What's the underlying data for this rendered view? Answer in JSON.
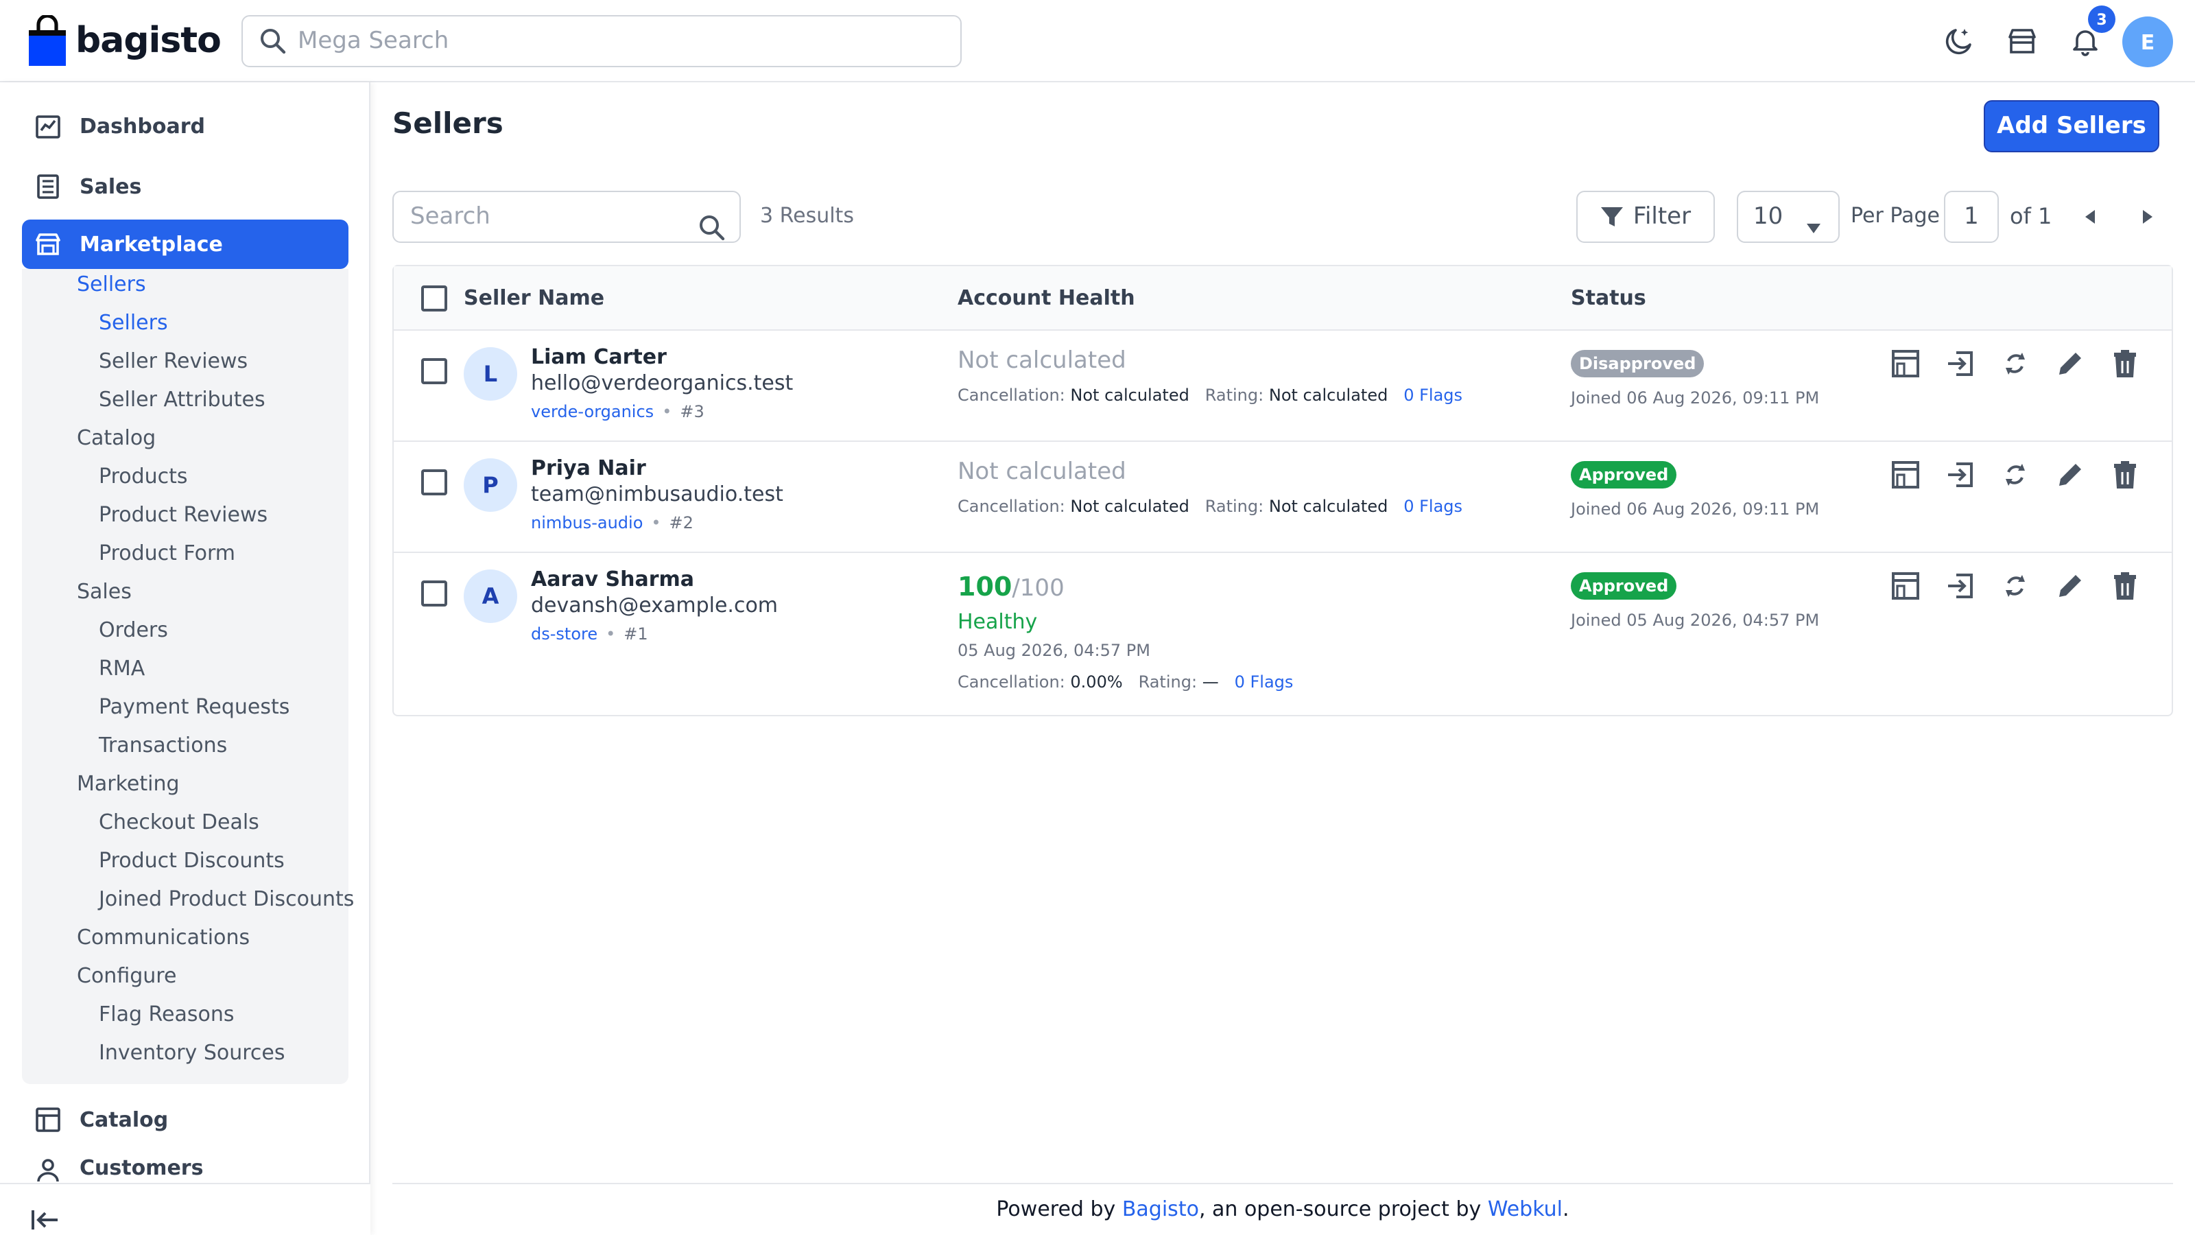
{
  "header": {
    "brand": "bagisto",
    "search_placeholder": "Mega Search",
    "notification_count": "3",
    "user_initial": "E",
    "colors": {
      "brand_blue": "#0041ff",
      "accent": "#2563eb"
    }
  },
  "sidebar": {
    "dashboard": "Dashboard",
    "sales": "Sales",
    "marketplace": "Marketplace",
    "catalog": "Catalog",
    "customers": "Customers",
    "marketplace_menu": {
      "sellers": "Sellers",
      "sellers_sub": "Sellers",
      "seller_reviews": "Seller Reviews",
      "seller_attributes": "Seller Attributes",
      "catalog": "Catalog",
      "products": "Products",
      "product_reviews": "Product Reviews",
      "product_form": "Product Form",
      "sales": "Sales",
      "orders": "Orders",
      "rma": "RMA",
      "payment_requests": "Payment Requests",
      "transactions": "Transactions",
      "marketing": "Marketing",
      "checkout_deals": "Checkout Deals",
      "product_discounts": "Product Discounts",
      "joined_product_discounts": "Joined Product Discounts",
      "communications": "Communications",
      "configure": "Configure",
      "flag_reasons": "Flag Reasons",
      "inventory_sources": "Inventory Sources"
    }
  },
  "main": {
    "title": "Sellers",
    "add_button": "Add Sellers",
    "search_placeholder": "Search",
    "results": "3 Results",
    "filter": "Filter",
    "per_page_value": "10",
    "per_page_label": "Per Page",
    "page": "1",
    "of_pages": "of 1",
    "columns": {
      "name": "Seller Name",
      "health": "Account Health",
      "status": "Status"
    },
    "rows": [
      {
        "initial": "L",
        "name": "Liam Carter",
        "email": "hello@verdeorganics.test",
        "slug": "verde-organics",
        "id": "#3",
        "health": "Not calculated",
        "cancel_label": "Cancellation:",
        "cancel_value": "Not calculated",
        "rating_label": "Rating:",
        "rating_value": "Not calculated",
        "flags": "0 Flags",
        "status": "Disapproved",
        "joined": "Joined 06 Aug 2026, 09:11 PM"
      },
      {
        "initial": "P",
        "name": "Priya Nair",
        "email": "team@nimbusaudio.test",
        "slug": "nimbus-audio",
        "id": "#2",
        "health": "Not calculated",
        "cancel_label": "Cancellation:",
        "cancel_value": "Not calculated",
        "rating_label": "Rating:",
        "rating_value": "Not calculated",
        "flags": "0 Flags",
        "status": "Approved",
        "joined": "Joined 06 Aug 2026, 09:11 PM"
      },
      {
        "initial": "A",
        "name": "Aarav Sharma",
        "email": "devansh@example.com",
        "slug": "ds-store",
        "id": "#1",
        "score": "100",
        "score_max": "/100",
        "health_label": "Healthy",
        "health_date": "05 Aug 2026, 04:57 PM",
        "cancel_label": "Cancellation:",
        "cancel_value": "0.00%",
        "rating_label": "Rating:",
        "rating_value": "—",
        "flags": "0 Flags",
        "status": "Approved",
        "joined": "Joined 05 Aug 2026, 04:57 PM"
      }
    ]
  },
  "footer": {
    "prefix": "Powered by ",
    "bagisto": "Bagisto",
    "middle": ", an open-source project by ",
    "webkul": "Webkul",
    "suffix": "."
  }
}
